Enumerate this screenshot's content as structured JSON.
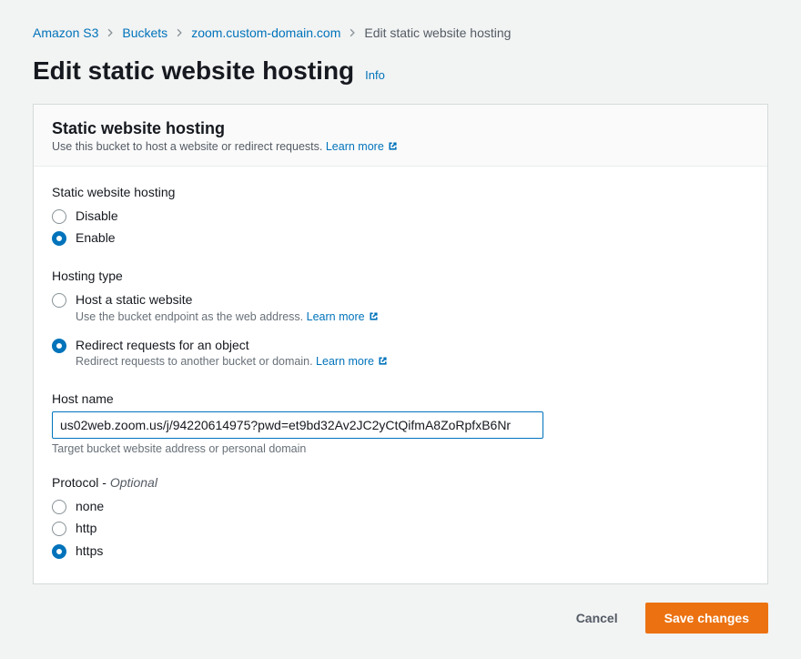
{
  "breadcrumbs": {
    "items": [
      {
        "label": "Amazon S3"
      },
      {
        "label": "Buckets"
      },
      {
        "label": "zoom.custom-domain.com"
      }
    ],
    "current": "Edit static website hosting"
  },
  "page": {
    "title": "Edit static website hosting",
    "info_label": "Info"
  },
  "panel": {
    "title": "Static website hosting",
    "subtitle_prefix": "Use this bucket to host a website or redirect requests. ",
    "learn_more": "Learn more"
  },
  "fields": {
    "static_hosting": {
      "label": "Static website hosting",
      "options": {
        "disable": "Disable",
        "enable": "Enable"
      },
      "selected": "enable"
    },
    "hosting_type": {
      "label": "Hosting type",
      "options": {
        "host": {
          "label": "Host a static website",
          "desc_prefix": "Use the bucket endpoint as the web address. ",
          "learn_more": "Learn more"
        },
        "redirect": {
          "label": "Redirect requests for an object",
          "desc_prefix": "Redirect requests to another bucket or domain. ",
          "learn_more": "Learn more"
        }
      },
      "selected": "redirect"
    },
    "host_name": {
      "label": "Host name",
      "value": "us02web.zoom.us/j/94220614975?pwd=et9bd32Av2JC2yCtQifmA8ZoRpfxB6Nr",
      "hint": "Target bucket website address or personal domain"
    },
    "protocol": {
      "label_main": "Protocol - ",
      "label_optional": "Optional",
      "options": {
        "none": "none",
        "http": "http",
        "https": "https"
      },
      "selected": "https"
    }
  },
  "buttons": {
    "cancel": "Cancel",
    "save": "Save changes"
  }
}
